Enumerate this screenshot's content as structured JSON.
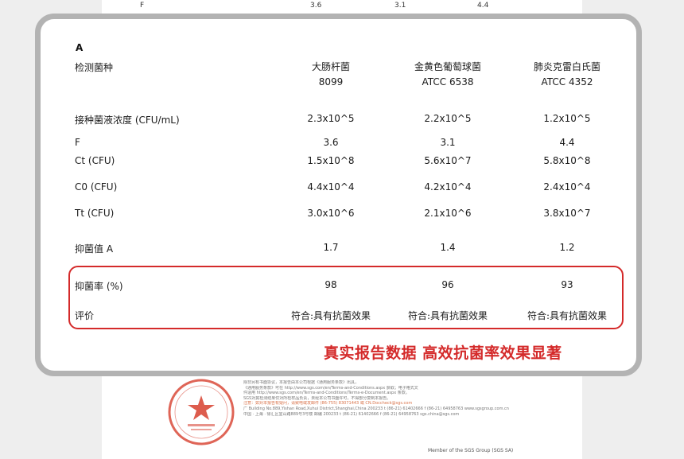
{
  "top_row": {
    "label": "F",
    "values": [
      "3.6",
      "3.1",
      "4.4"
    ]
  },
  "table": {
    "section": "A",
    "header_label": "检测菌种",
    "organisms": [
      {
        "name": "大肠杆菌",
        "code": "8099"
      },
      {
        "name": "金黄色葡萄球菌",
        "code": "ATCC 6538"
      },
      {
        "name": "肺炎克雷白氏菌",
        "code": "ATCC 4352"
      }
    ],
    "rows": [
      {
        "label": "接种菌液浓度 (CFU/mL)",
        "values": [
          "2.3x10^5",
          "2.2x10^5",
          "1.2x10^5"
        ]
      },
      {
        "label": "F",
        "values": [
          "3.6",
          "3.1",
          "4.4"
        ]
      },
      {
        "label": "Ct (CFU)",
        "values": [
          "1.5x10^8",
          "5.6x10^7",
          "5.8x10^8"
        ]
      },
      {
        "label": "C0 (CFU)",
        "values": [
          "4.4x10^4",
          "4.2x10^4",
          "2.4x10^4"
        ]
      },
      {
        "label": "Tt (CFU)",
        "values": [
          "3.0x10^6",
          "2.1x10^6",
          "3.8x10^7"
        ]
      },
      {
        "label": "抑菌值 A",
        "values": [
          "1.7",
          "1.4",
          "1.2"
        ]
      }
    ],
    "highlight_rows": [
      {
        "label": "抑菌率 (%)",
        "values": [
          "98",
          "96",
          "93"
        ]
      },
      {
        "label": "评价",
        "values": [
          "符合:具有抗菌效果",
          "符合:具有抗菌效果",
          "符合:具有抗菌效果"
        ]
      }
    ]
  },
  "slogan": "真实报告数据 高效抗菌率效果显著",
  "fine_print": {
    "lines": [
      "除非另有书面协议，本报告由本公司根据《通用服务条款》出具，",
      "《通用服务条款》可在 http://www.sgs.com/en/Terms-and-Conditions.aspx 获取；电子格式文",
      "件适用 http://www.sgs.com/en/Terms-and-Conditions/Terms-e-Document.aspx 条款。",
      "SGS对其检测结果仅对所检样品负责，未经本公司书面许可，不得部分复制本报告。",
      "注意：如对本报告有疑问，请致电或发邮件 (86-755) 83071443 或 CN.Doccheck@sgs.com",
      "广 Building No.889,Yishan Road,Xuhui District,Shanghai,China   200233   t (86-21) 61402666   f (86-21) 64958763   www.sgsgroup.com.cn",
      "中国 · 上海 · 徐汇区宜山路889号3号楼 邮编 200233   t (86-21) 61402666   f (86-21) 64958763   sgs.china@sgs.com"
    ],
    "member": "Member of the SGS Group (SGS SA)"
  },
  "colors": {
    "accent_red": "#d42a2a",
    "card_border": "#b3b3b3",
    "seal_red": "#d94a3a"
  }
}
